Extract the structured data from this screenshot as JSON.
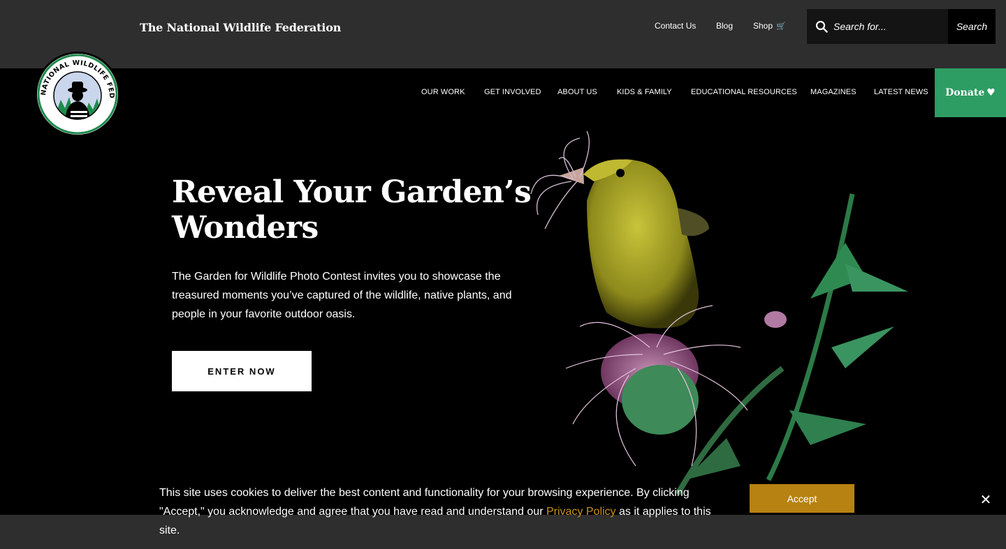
{
  "header": {
    "site_name": "The National Wildlife Federation",
    "utility_links": [
      "Contact Us",
      "Blog",
      "Shop"
    ],
    "cart_icon": "cart-icon",
    "search": {
      "placeholder": "Search for...",
      "button_label": "Search",
      "icon": "search-icon"
    }
  },
  "logo": {
    "ring_text": "NATIONAL WILDLIFE FEDERATION",
    "icon": "nwf-ranger-logo"
  },
  "nav": {
    "items": [
      "OUR WORK",
      "GET INVOLVED",
      "ABOUT US",
      "KIDS & FAMILY",
      "EDUCATIONAL RESOURCES",
      "MAGAZINES",
      "LATEST NEWS"
    ],
    "donate_label": "Donate",
    "donate_icon": "heart-icon",
    "donate_color": "#2e9d63"
  },
  "hero": {
    "title": "Reveal Your Garden’s Wonders",
    "text": "The Garden for Wildlife Photo Contest invites you to showcase the treasured moments you’ve captured of the wildlife, native plants, and people in your favorite outdoor oasis.",
    "cta_label": "ENTER NOW",
    "image": "bird-on-thistle-photo"
  },
  "cookie": {
    "text_before": "This site uses cookies to deliver the best content and functionality for your browsing experience. By clicking \"Accept,\" you acknowledge and agree that you have read and understand our ",
    "link_text": "Privacy Policy",
    "text_after": " as it applies to this site.",
    "accept_label": "Accept",
    "close_label": "✕",
    "accent_color": "#b78212"
  }
}
